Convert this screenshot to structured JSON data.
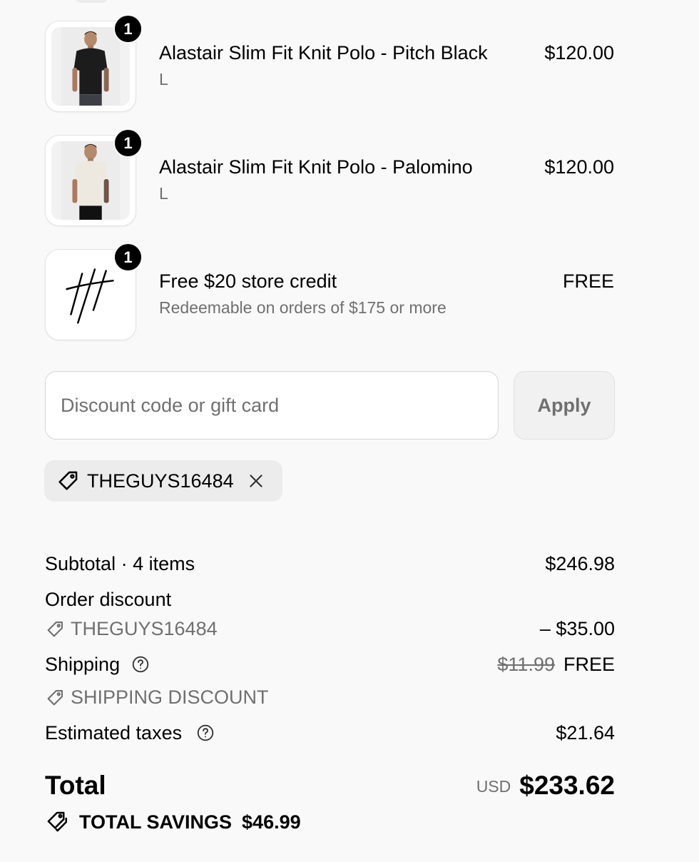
{
  "line_items": [
    {
      "title": "Alastair Slim Fit Knit Polo - Pitch Black",
      "variant": "L",
      "price": "$120.00",
      "quantity": "1",
      "image": "black-polo-model"
    },
    {
      "title": "Alastair Slim Fit Knit Polo - Palomino",
      "variant": "L",
      "price": "$120.00",
      "quantity": "1",
      "image": "cream-polo-model"
    },
    {
      "title": "Free $20 store credit",
      "variant": "Redeemable on orders of $175 or more",
      "price": "FREE",
      "quantity": "1",
      "image": "brand-logo"
    }
  ],
  "discount": {
    "placeholder": "Discount code or gift card",
    "value": "",
    "apply_label": "Apply",
    "applied_code": "THEGUYS16484"
  },
  "summary": {
    "subtotal_label": "Subtotal · 4 items",
    "subtotal_value": "$246.98",
    "order_discount_label": "Order discount",
    "order_discount_code": "THEGUYS16484",
    "order_discount_value": "– $35.00",
    "shipping_label": "Shipping",
    "shipping_original": "$11.99",
    "shipping_value": "FREE",
    "shipping_discount_label": "SHIPPING DISCOUNT",
    "taxes_label": "Estimated taxes",
    "taxes_value": "$21.64",
    "total_label": "Total",
    "currency": "USD",
    "total_value": "$233.62",
    "savings_label": "TOTAL SAVINGS",
    "savings_value": "$46.99"
  },
  "colors": {
    "background": "#f9f9f9",
    "muted_text": "#707070",
    "badge": "#000000",
    "chip_background": "#ececec"
  }
}
